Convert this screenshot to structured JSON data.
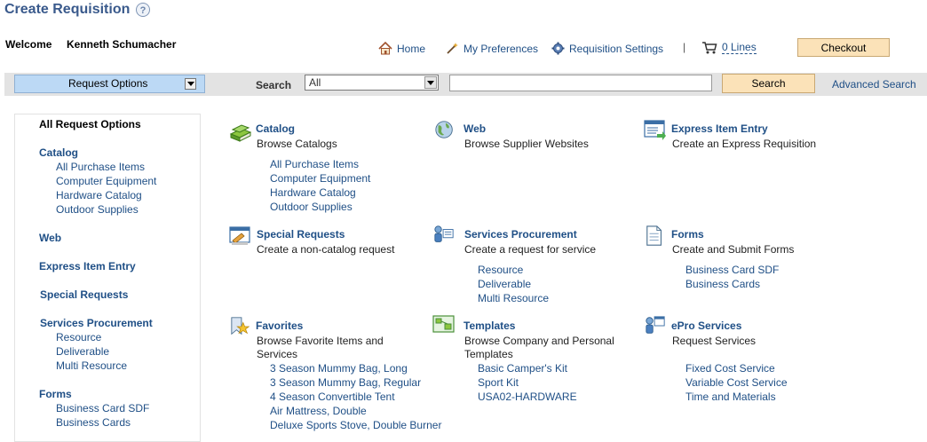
{
  "header": {
    "title": "Create Requisition",
    "help_icon": "?",
    "welcome_label": "Welcome",
    "user_name": "Kenneth Schumacher"
  },
  "toplinks": {
    "home": "Home",
    "preferences": "My Preferences",
    "settings": "Requisition Settings",
    "separator": "|",
    "cart": "0 Lines",
    "checkout": "Checkout"
  },
  "toolbar": {
    "request_options": "Request Options",
    "search_label": "Search",
    "search_scope": "All",
    "search_value": "",
    "search_button": "Search",
    "advanced_search": "Advanced Search"
  },
  "leftnav": {
    "heading": "All Request Options",
    "catalog": "Catalog",
    "catalog_items": [
      "All Purchase Items",
      "Computer Equipment",
      "Hardware Catalog",
      "Outdoor Supplies"
    ],
    "web": "Web",
    "express": "Express Item Entry",
    "special": "Special Requests",
    "services": "Services Procurement",
    "services_items": [
      "Resource",
      "Deliverable",
      "Multi Resource"
    ],
    "forms": "Forms",
    "forms_items": [
      "Business Card SDF",
      "Business Cards"
    ]
  },
  "main": {
    "catalog": {
      "title": "Catalog",
      "desc": "Browse Catalogs",
      "links": [
        "All Purchase Items",
        "Computer Equipment",
        "Hardware Catalog",
        "Outdoor Supplies"
      ]
    },
    "web": {
      "title": "Web",
      "desc": "Browse Supplier Websites"
    },
    "express": {
      "title": "Express Item Entry",
      "desc": "Create an Express Requisition"
    },
    "special": {
      "title": "Special Requests",
      "desc": "Create a non-catalog request"
    },
    "services": {
      "title": "Services Procurement",
      "desc": "Create a request for service",
      "links": [
        "Resource",
        "Deliverable",
        "Multi Resource"
      ]
    },
    "forms": {
      "title": "Forms",
      "desc": "Create and Submit Forms",
      "links": [
        "Business Card SDF",
        "Business Cards"
      ]
    },
    "favorites": {
      "title": "Favorites",
      "desc1": "Browse Favorite Items and",
      "desc2": "Services",
      "links": [
        "3 Season Mummy Bag, Long",
        "3 Season Mummy Bag, Regular",
        "4 Season Convertible Tent",
        "Air Mattress, Double",
        "Deluxe Sports Stove, Double Burner"
      ]
    },
    "templates": {
      "title": "Templates",
      "desc1": "Browse Company and Personal",
      "desc2": "Templates",
      "links": [
        "Basic Camper's Kit",
        "Sport Kit",
        "USA02-HARDWARE"
      ]
    },
    "epro": {
      "title": "ePro Services",
      "desc": "Request Services",
      "links": [
        "Fixed Cost Service",
        "Variable Cost Service",
        "Time and Materials"
      ]
    }
  },
  "colors": {
    "link": "#1f4f86",
    "title": "#3a5a8c",
    "button_bg": "#fbe2b8",
    "request_options_bg": "#bcd9f5",
    "toolbar_bg": "#e3e3e3"
  }
}
